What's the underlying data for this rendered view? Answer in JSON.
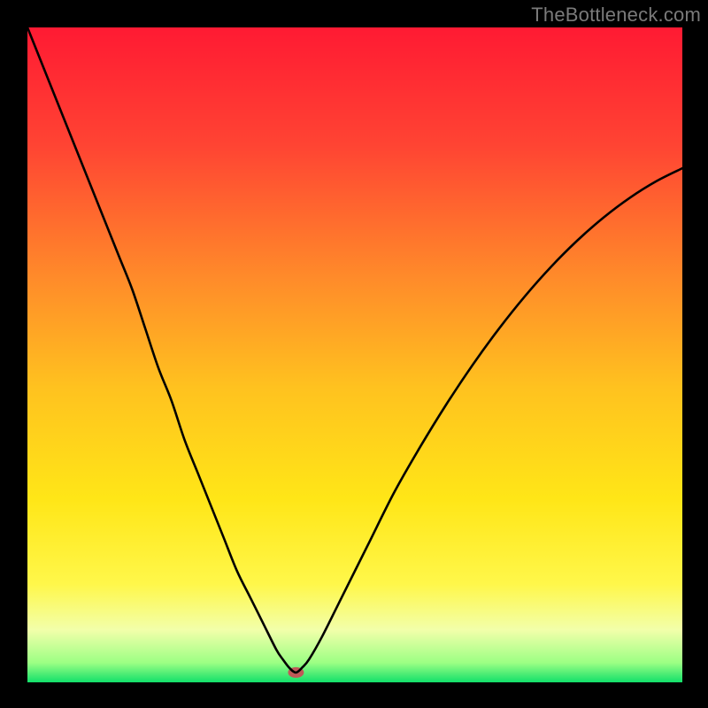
{
  "watermark": "TheBottleneck.com",
  "chart_data": {
    "type": "line",
    "title": "",
    "xlabel": "",
    "ylabel": "",
    "xlim": [
      0,
      100
    ],
    "ylim": [
      0,
      100
    ],
    "grid": false,
    "legend": false,
    "background_gradient": {
      "stops": [
        {
          "offset": 0.0,
          "color": "#ff1a33"
        },
        {
          "offset": 0.18,
          "color": "#ff4433"
        },
        {
          "offset": 0.38,
          "color": "#ff8a2a"
        },
        {
          "offset": 0.55,
          "color": "#ffc21f"
        },
        {
          "offset": 0.72,
          "color": "#ffe617"
        },
        {
          "offset": 0.85,
          "color": "#fff74a"
        },
        {
          "offset": 0.92,
          "color": "#f2ffaa"
        },
        {
          "offset": 0.97,
          "color": "#9cff84"
        },
        {
          "offset": 1.0,
          "color": "#12e06a"
        }
      ]
    },
    "marker": {
      "x": 41,
      "y": 1.5,
      "color": "#c05858",
      "rx": 9,
      "ry": 6
    },
    "series": [
      {
        "name": "curve",
        "color": "#000000",
        "stroke_width": 2.6,
        "x": [
          0,
          2,
          4,
          6,
          8,
          10,
          12,
          14,
          16,
          18,
          20,
          22,
          24,
          26,
          28,
          30,
          32,
          34,
          36,
          38,
          39,
          40,
          41,
          42,
          43,
          45,
          48,
          52,
          56,
          60,
          64,
          68,
          72,
          76,
          80,
          84,
          88,
          92,
          96,
          100
        ],
        "y": [
          100,
          95,
          90,
          85,
          80,
          75,
          70,
          65,
          60,
          54,
          48,
          43,
          37,
          32,
          27,
          22,
          17,
          13,
          9,
          5,
          3.5,
          2.2,
          1.5,
          2.3,
          3.5,
          7,
          13,
          21,
          29,
          36,
          42.5,
          48.5,
          54,
          59,
          63.5,
          67.5,
          71,
          74,
          76.5,
          78.5
        ]
      }
    ]
  }
}
